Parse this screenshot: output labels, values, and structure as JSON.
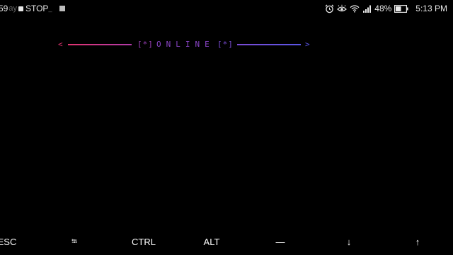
{
  "status_bar": {
    "timer": "59",
    "day_fade": "ay",
    "stop_label": "STOP",
    "stop_fade": "_",
    "battery_percent": "48%",
    "clock": "5:13 PM",
    "icons": [
      "record-dot-icon",
      "stop-square-icon",
      "alarm-icon",
      "eye-comfort-icon",
      "wifi-icon",
      "signal-icon",
      "battery-icon"
    ]
  },
  "banner": {
    "arrow_left": "<",
    "bracket_left": "[*]",
    "status_word": "ONLINE",
    "bracket_right": "[*]",
    "arrow_right": ">",
    "colors": {
      "start": "#e0336f",
      "middle": "#8a45c8",
      "end": "#5a55e6"
    }
  },
  "extra_keys": {
    "esc": "ESC",
    "tab": "⭾",
    "ctrl": "CTRL",
    "alt": "ALT",
    "dash": "—",
    "down": "↓",
    "up": "↑"
  }
}
